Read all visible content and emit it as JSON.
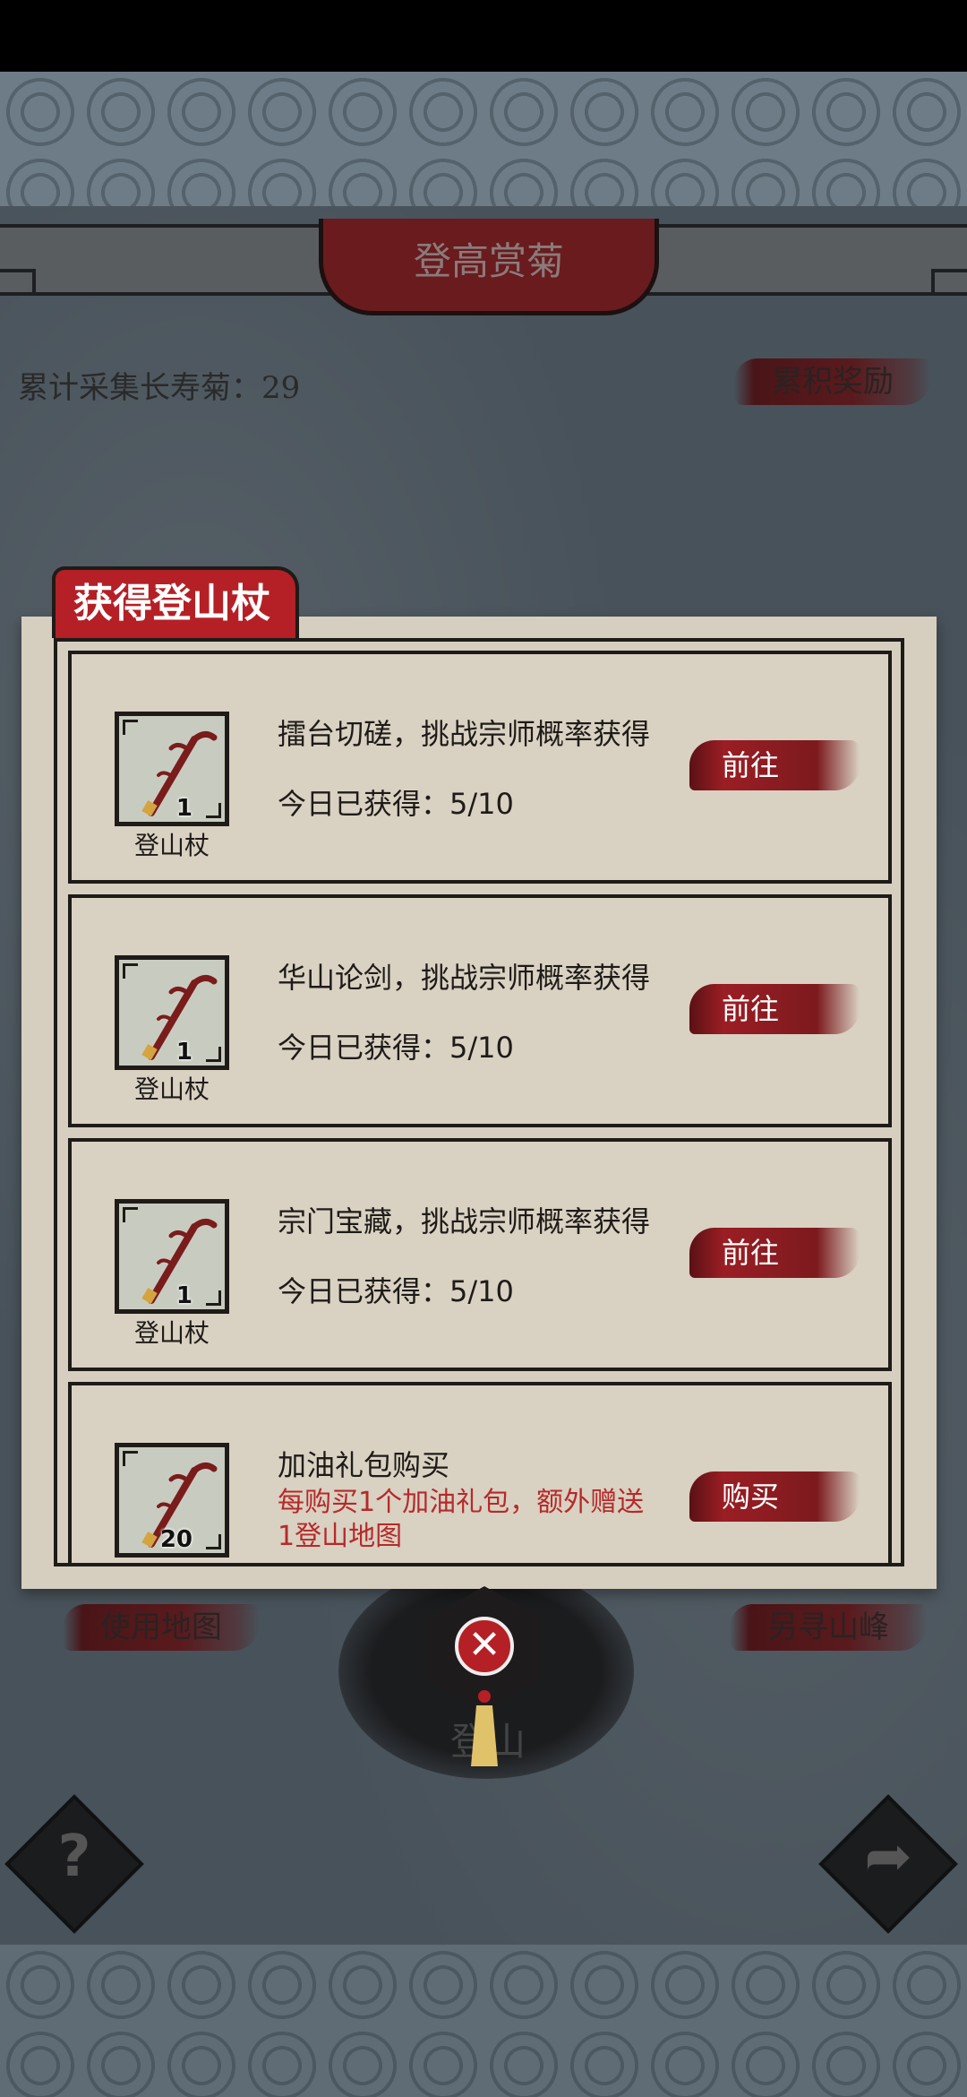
{
  "header": {
    "title": "登高赏菊"
  },
  "counter": {
    "label": "累计采集长寿菊：29"
  },
  "buttons": {
    "cumulative_rewards": "累积奖励",
    "use_map": "使用地图",
    "find_other_peak": "另寻山峰",
    "climb": "登山"
  },
  "panel": {
    "title": "获得登山杖",
    "rows": [
      {
        "item_name": "登山杖",
        "item_count": "1",
        "title": "擂台切磋，挑战宗师概率获得",
        "progress": "今日已获得：5/10",
        "action": "前往"
      },
      {
        "item_name": "登山杖",
        "item_count": "1",
        "title": "华山论剑，挑战宗师概率获得",
        "progress": "今日已获得：5/10",
        "action": "前往"
      },
      {
        "item_name": "登山杖",
        "item_count": "1",
        "title": "宗门宝藏，挑战宗师概率获得",
        "progress": "今日已获得：5/10",
        "action": "前往"
      },
      {
        "item_name": "登山杖",
        "item_count": "20",
        "title": "加油礼包购买",
        "note": "每购买1个加油礼包，额外赠送1登山地图",
        "action": "购买"
      }
    ]
  },
  "icons": {
    "close": "close-icon",
    "help": "question-mark-icon",
    "share": "share-arrow-icon",
    "staff": "climbing-staff-icon"
  },
  "colors": {
    "accent_red": "#b42026",
    "panel_paper": "#d6cfc0",
    "text_dark": "#1e1b18",
    "note_red": "#b52a2a"
  }
}
